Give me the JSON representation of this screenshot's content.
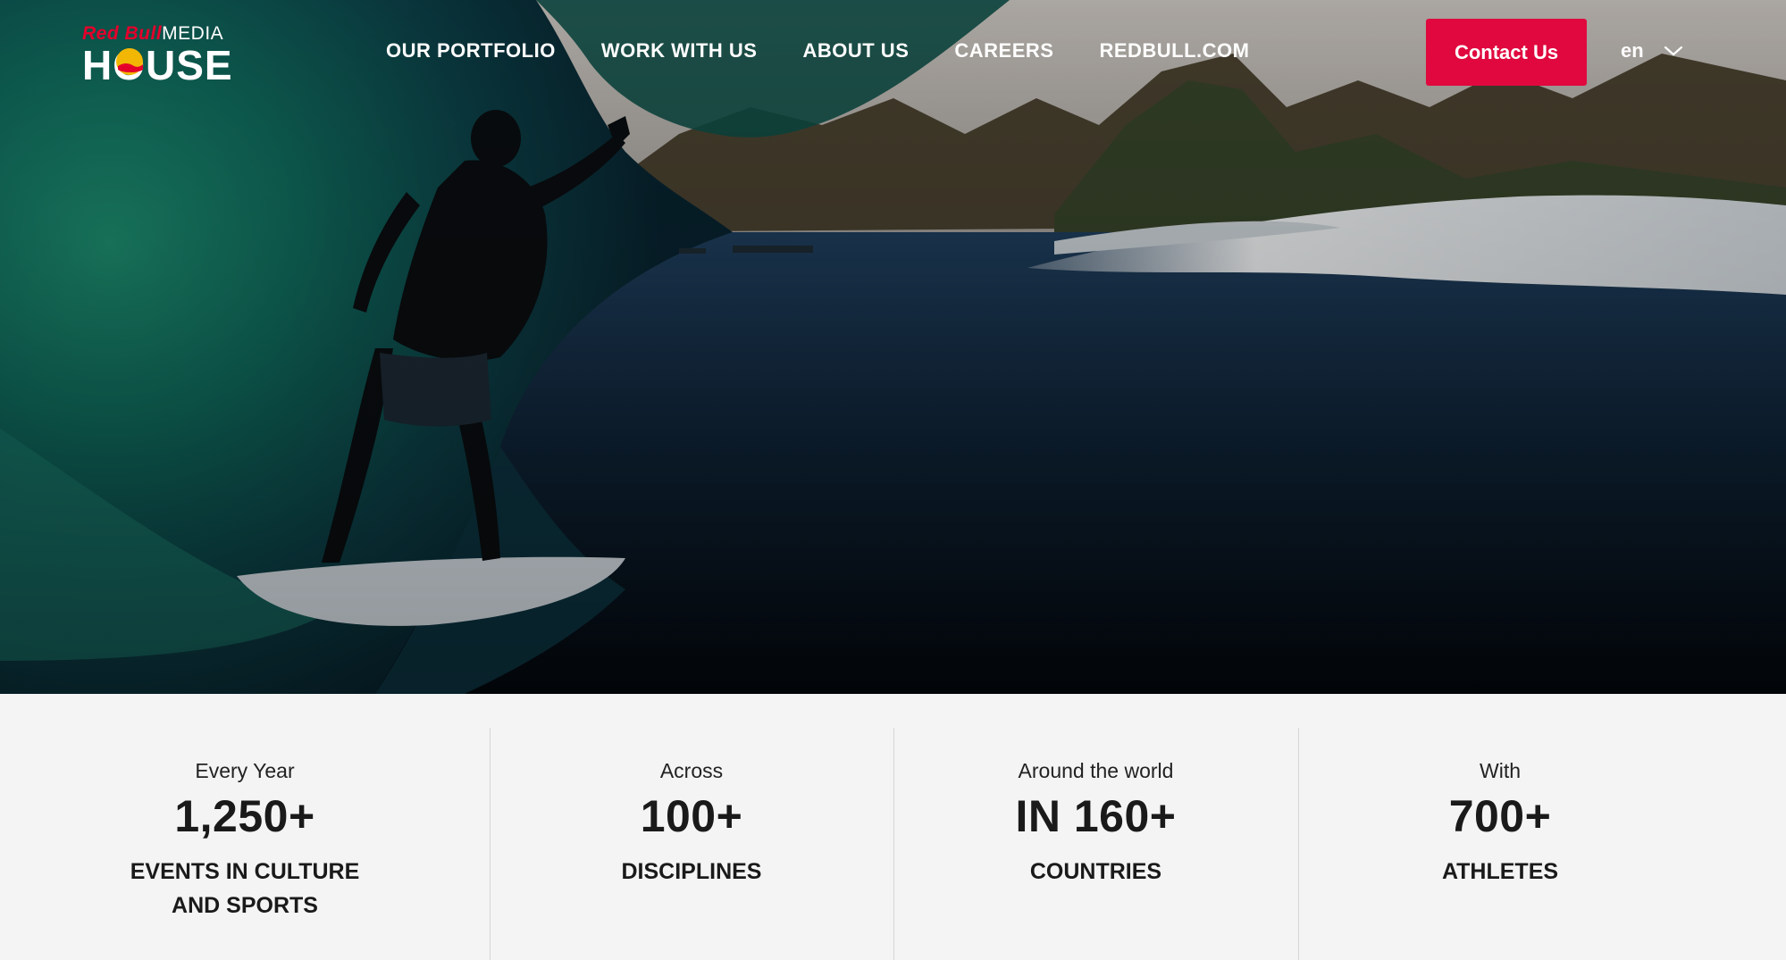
{
  "brand": {
    "logo_top_brand": "Red Bull",
    "logo_top_suffix": "MEDIA",
    "logo_main": "HOUSE",
    "accent_color": "#e0083e"
  },
  "nav": {
    "items": [
      {
        "label": "OUR PORTFOLIO"
      },
      {
        "label": "WORK WITH US"
      },
      {
        "label": "ABOUT US"
      },
      {
        "label": "CAREERS"
      },
      {
        "label": "REDBULL.COM"
      }
    ],
    "contact_label": "Contact Us",
    "language": "en",
    "language_icon": "chevron-down-icon"
  },
  "hero": {
    "image": "surfer-in-barrel-wave"
  },
  "stats": [
    {
      "pre": "Every Year",
      "number": "1,250+",
      "label": "EVENTS IN CULTURE AND SPORTS"
    },
    {
      "pre": "Across",
      "number": "100+",
      "label": "DISCIPLINES"
    },
    {
      "pre": "Around the world",
      "number": "IN 160+",
      "label": "COUNTRIES"
    },
    {
      "pre": "With",
      "number": "700+",
      "label": "ATHLETES"
    }
  ]
}
